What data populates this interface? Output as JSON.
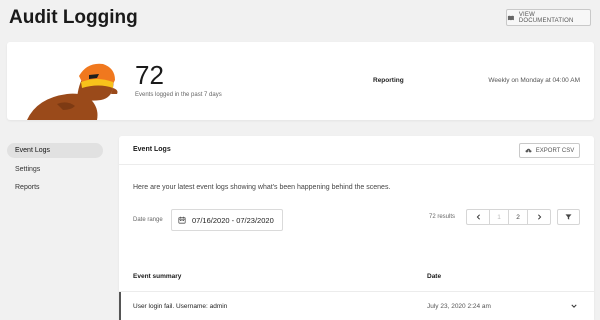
{
  "header": {
    "title": "Audit Logging",
    "doc_button": "VIEW DOCUMENTATION",
    "doc_icon": "book-icon"
  },
  "summary": {
    "count": "72",
    "count_label": "Events logged in the past 7 days",
    "reporting_label": "Reporting",
    "reporting_value": "Weekly on Monday at 04:00 AM",
    "mascot_colors": {
      "skin": "#9a4a1a",
      "mask": "#f0781e",
      "band": "#f8c21b"
    }
  },
  "sidebar": {
    "items": [
      {
        "label": "Event Logs",
        "active": true
      },
      {
        "label": "Settings",
        "active": false
      },
      {
        "label": "Reports",
        "active": false
      }
    ]
  },
  "panel": {
    "title": "Event Logs",
    "export_button": "EXPORT CSV",
    "export_icon": "cloud-download-icon",
    "intro": "Here are your latest event logs showing what's been happening behind the scenes.",
    "date_range_label": "Date range",
    "date_range_value": "07/16/2020 - 07/23/2020",
    "date_icon": "calendar-icon",
    "results": "72 results",
    "pagination": {
      "current": "1",
      "total": "2"
    },
    "filter_icon": "filter-icon",
    "columns": [
      "Event summary",
      "Date"
    ],
    "rows": [
      {
        "summary": "User login fail. Username: admin",
        "date": "July 23, 2020 2:24 am"
      }
    ]
  }
}
